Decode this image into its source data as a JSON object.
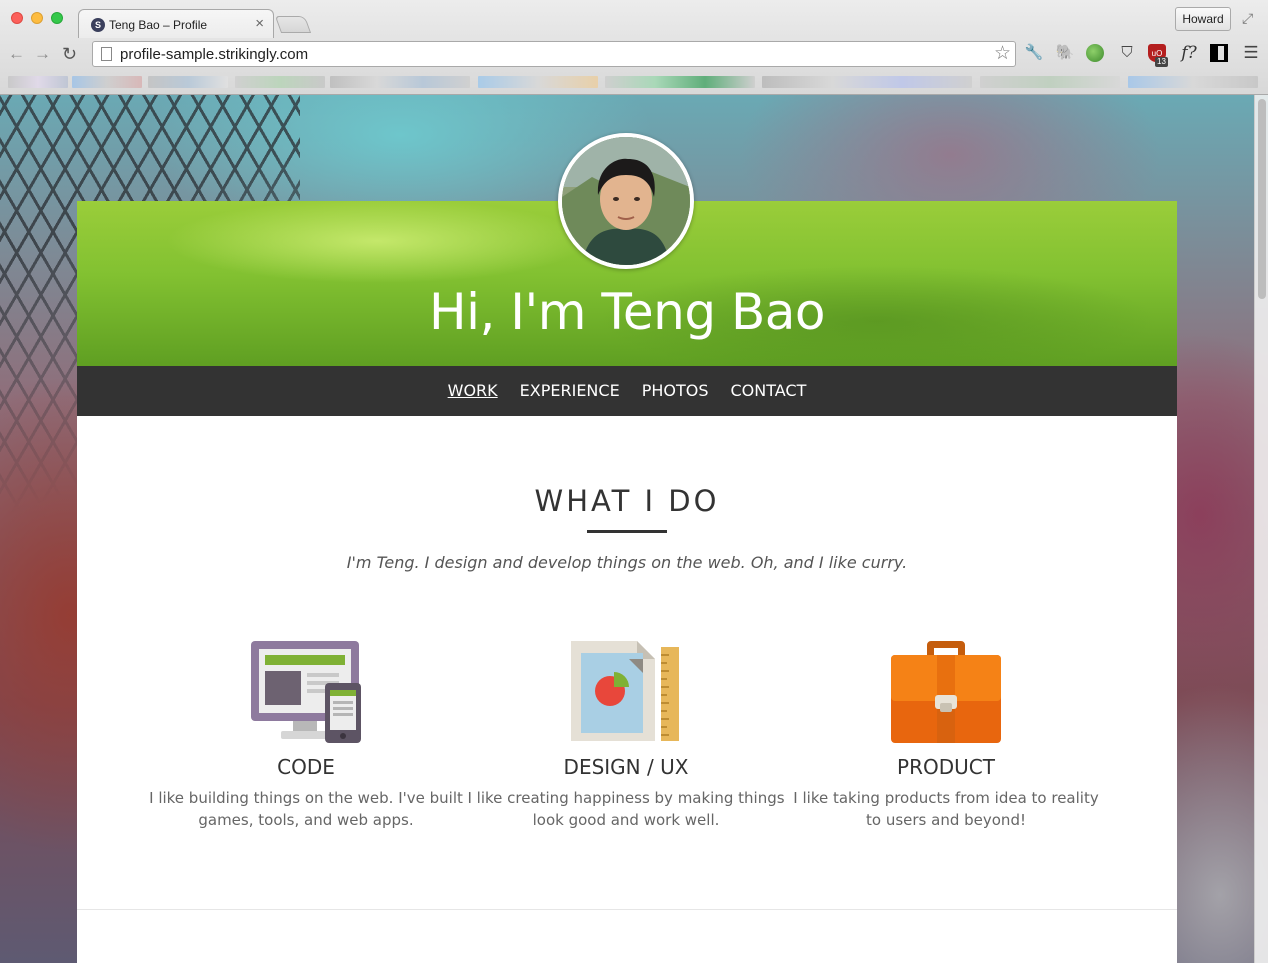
{
  "browser": {
    "tab_title": "Teng Bao – Profile",
    "tab_favicon_letter": "S",
    "profile_button": "Howard",
    "url": "profile-sample.strikingly.com",
    "ublock_badge": "13",
    "extensions": [
      "wrench-icon",
      "evernote-icon",
      "globe-icon",
      "pocket-icon",
      "ublock-icon",
      "fontface-icon",
      "qr-code-icon",
      "menu-icon"
    ]
  },
  "hero": {
    "title": "Hi, I'm Teng Bao"
  },
  "nav": {
    "items": [
      {
        "label": "WORK",
        "active": true
      },
      {
        "label": "EXPERIENCE",
        "active": false
      },
      {
        "label": "PHOTOS",
        "active": false
      },
      {
        "label": "CONTACT",
        "active": false
      }
    ]
  },
  "section": {
    "title": "WHAT I DO",
    "tagline": "I'm Teng. I design and develop things on the web. Oh, and I like curry."
  },
  "features": [
    {
      "title": "CODE",
      "description": "I like building things on the web. I've built games, tools, and web apps.",
      "icon": "monitor-phone-icon"
    },
    {
      "title": "DESIGN / UX",
      "description": "I like creating happiness by making things look good and work well.",
      "icon": "document-chart-icon"
    },
    {
      "title": "PRODUCT",
      "description": "I like taking products from idea to reality to users and beyond!",
      "icon": "briefcase-icon"
    }
  ],
  "colors": {
    "nav_bg": "#333333",
    "hero_green": "#82c131",
    "briefcase_orange": "#f07d13"
  }
}
